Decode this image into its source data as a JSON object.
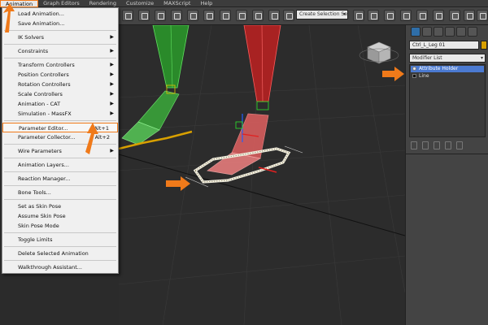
{
  "menubar": {
    "items": [
      "Animation",
      "Graph Editors",
      "Rendering",
      "Customize",
      "MAXScript",
      "Help"
    ],
    "active": "Animation"
  },
  "toolbar": {
    "selection_set": "Create Selection Se"
  },
  "animation_menu": {
    "items": [
      {
        "label": "Load Animation..."
      },
      {
        "label": "Save Animation..."
      },
      {
        "label": "IK Solvers",
        "submenu": true
      },
      {
        "label": "Constraints",
        "submenu": true
      },
      {
        "label": "Transform Controllers",
        "submenu": true
      },
      {
        "label": "Position Controllers",
        "submenu": true
      },
      {
        "label": "Rotation Controllers",
        "submenu": true
      },
      {
        "label": "Scale Controllers",
        "submenu": true
      },
      {
        "label": "Animation - CAT",
        "submenu": true
      },
      {
        "label": "Simulation - MassFX",
        "submenu": true
      },
      {
        "label": "Parameter Editor...",
        "shortcut": "Alt+1",
        "highlighted": true
      },
      {
        "label": "Parameter Collector...",
        "shortcut": "Alt+2"
      },
      {
        "label": "Wire Parameters",
        "submenu": true
      },
      {
        "label": "Animation Layers..."
      },
      {
        "label": "Reaction Manager..."
      },
      {
        "label": "Bone Tools..."
      },
      {
        "label": "Set as Skin Pose"
      },
      {
        "label": "Assume Skin Pose"
      },
      {
        "label": "Skin Pose Mode"
      },
      {
        "label": "Toggle Limits"
      },
      {
        "label": "Delete Selected Animation"
      },
      {
        "label": "Walkthrough Assistant..."
      }
    ]
  },
  "command_panel": {
    "object_name": "Ctrl_L_Leg 01",
    "object_color": "#d8a000",
    "modifier_list": "Modifier List",
    "stack": [
      {
        "label": "Attribute Holder",
        "selected": true
      },
      {
        "label": "Line",
        "selected": false
      }
    ]
  },
  "colors": {
    "accent_orange": "#f07a1a",
    "selection_blue": "#4b7ad1",
    "leg_red": "#e04040",
    "leg_green": "#4cc94c"
  }
}
